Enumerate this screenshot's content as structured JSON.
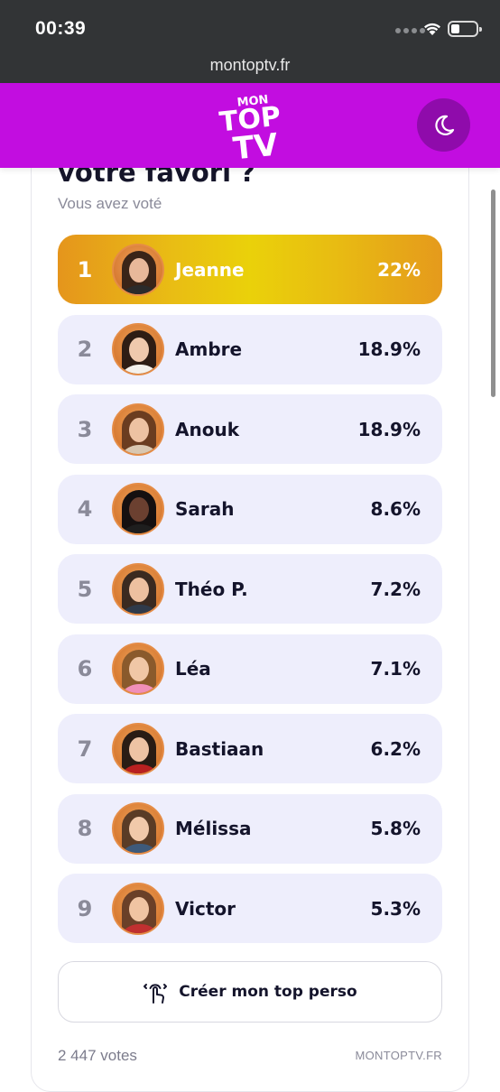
{
  "status_bar": {
    "time": "00:39",
    "url": "montoptv.fr"
  },
  "header": {
    "logo": {
      "line1": "MON",
      "line2": "TOP",
      "line3": "TV"
    },
    "theme_toggle_icon": "moon-icon"
  },
  "poll": {
    "title": "votre favori ?",
    "subtitle": "Vous avez voté",
    "results": [
      {
        "rank": "1",
        "name": "Jeanne",
        "percent": "22%",
        "value": 22,
        "winner": true,
        "hair": "#3a2418",
        "skin": "#e8b89a",
        "top": "#2b2b2b"
      },
      {
        "rank": "2",
        "name": "Ambre",
        "percent": "18.9%",
        "value": 18.9,
        "winner": false,
        "hair": "#2e1d14",
        "skin": "#efc9ad",
        "top": "#f4f1ec"
      },
      {
        "rank": "3",
        "name": "Anouk",
        "percent": "18.9%",
        "value": 18.9,
        "winner": false,
        "hair": "#6b3d20",
        "skin": "#edc2a2",
        "top": "#d9c7b0"
      },
      {
        "rank": "4",
        "name": "Sarah",
        "percent": "8.6%",
        "value": 8.6,
        "winner": false,
        "hair": "#151010",
        "skin": "#6b4030",
        "top": "#1e1e1e"
      },
      {
        "rank": "5",
        "name": "Théo P.",
        "percent": "7.2%",
        "value": 7.2,
        "winner": false,
        "hair": "#3b2a20",
        "skin": "#edc0a0",
        "top": "#2f3a4a"
      },
      {
        "rank": "6",
        "name": "Léa",
        "percent": "7.1%",
        "value": 7.1,
        "winner": false,
        "hair": "#8a5a2c",
        "skin": "#f0c7a6",
        "top": "#f08fb8"
      },
      {
        "rank": "7",
        "name": "Bastiaan",
        "percent": "6.2%",
        "value": 6.2,
        "winner": false,
        "hair": "#2a1c14",
        "skin": "#eec3a4",
        "top": "#b92020"
      },
      {
        "rank": "8",
        "name": "Mélissa",
        "percent": "5.8%",
        "value": 5.8,
        "winner": false,
        "hair": "#5a3c26",
        "skin": "#f1c9aa",
        "top": "#3e5a7a"
      },
      {
        "rank": "9",
        "name": "Victor",
        "percent": "5.3%",
        "value": 5.3,
        "winner": false,
        "hair": "#6a4028",
        "skin": "#f0c4a2",
        "top": "#c03030"
      }
    ],
    "create_button": {
      "label": "Créer mon top perso",
      "icon": "hand-gesture-icon"
    },
    "votes": "2 447 votes",
    "site_mark": "MONTOPTV.FR"
  },
  "colors": {
    "header_purple": "#c20de0",
    "toggle_purple": "#8f0bab",
    "row_bg": "#eeeefc",
    "winner_gold": "#ead10a",
    "winner_orange": "#e5951c"
  }
}
